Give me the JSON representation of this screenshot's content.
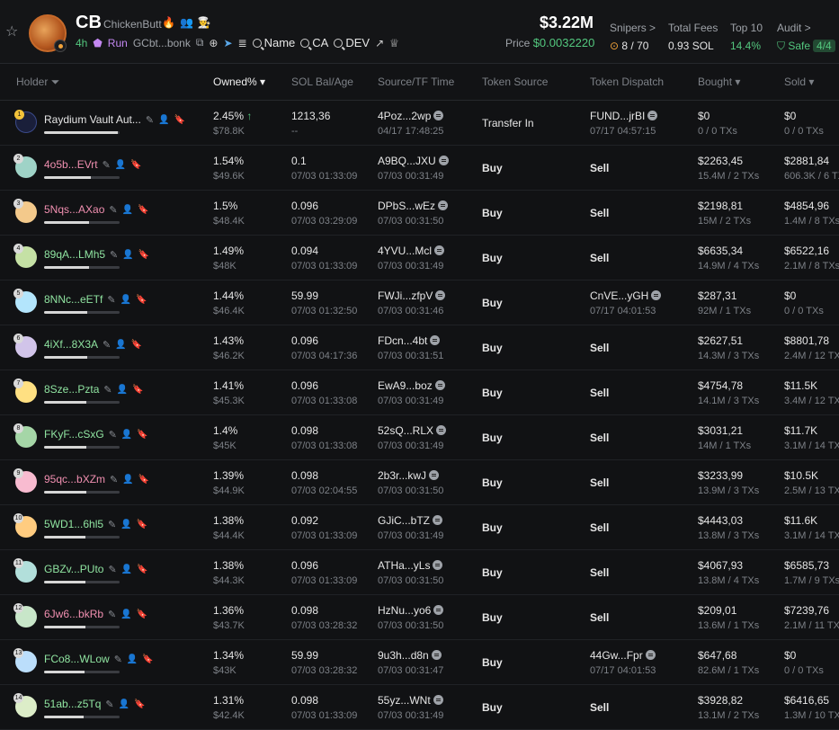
{
  "header": {
    "symbol": "CB",
    "name": "ChickenButt",
    "age": "4h",
    "status": "Run",
    "contract": "GCbt...bonk",
    "buttons": {
      "name": "Name",
      "ca": "CA",
      "dev": "DEV"
    },
    "market_cap": "$3.22M",
    "price_label": "Price",
    "price": "$0.0032220",
    "snipers_label": "Snipers >",
    "snipers": "8 / 70",
    "fees_label": "Total Fees",
    "fees": "0.93 SOL",
    "top10_label": "Top 10",
    "top10": "14.4%",
    "audit_label": "Audit >",
    "audit_status": "Safe",
    "audit_score": "4/4"
  },
  "columns": {
    "holder": "Holder",
    "owned": "Owned%",
    "sol_bal": "SOL Bal/Age",
    "source_tf": "Source/TF Time",
    "token_source": "Token Source",
    "token_dispatch": "Token Dispatch",
    "bought": "Bought",
    "sold": "Sold"
  },
  "rows": [
    {
      "rank": "1",
      "addr": "Raydium Vault Aut...",
      "addr_color": "#e6e6e6",
      "share": 0.245,
      "owned": "2.45%",
      "owned_usd": "$78.8K",
      "sol": "1213,36",
      "age": "--",
      "src": "4Poz...2wp",
      "src_time": "04/17 17:48:25",
      "tsrc": "Transfer In",
      "disp": "FUND...jrBI",
      "disp_time": "07/17 04:57:15",
      "bought": "$0",
      "bought_tx": "0 / 0 TXs",
      "sold": "$0",
      "sold_tx": "0 / 0 TXs",
      "icon": "raydium"
    },
    {
      "rank": "2",
      "addr": "4o5b...EVrt",
      "addr_color": "#f08fb0",
      "share": 0.154,
      "owned": "1.54%",
      "owned_usd": "$49.6K",
      "sol": "0.1",
      "age": "07/03 01:33:09",
      "src": "A9BQ...JXU",
      "src_time": "07/03 00:31:49",
      "tsrc": "Buy",
      "disp": "Sell",
      "disp_time": "",
      "bought": "$2263,45",
      "bought_tx": "15.4M / 2 TXs",
      "sold": "$2881,84",
      "sold_tx": "606.3K / 6 TX"
    },
    {
      "rank": "3",
      "addr": "5Nqs...AXao",
      "addr_color": "#f08fb0",
      "share": 0.15,
      "owned": "1.5%",
      "owned_usd": "$48.4K",
      "sol": "0.096",
      "age": "07/03 03:29:09",
      "src": "DPbS...wEz",
      "src_time": "07/03 00:31:50",
      "tsrc": "Buy",
      "disp": "Sell",
      "disp_time": "",
      "bought": "$2198,81",
      "bought_tx": "15M / 2 TXs",
      "sold": "$4854,96",
      "sold_tx": "1.4M / 8 TXs"
    },
    {
      "rank": "4",
      "addr": "89qA...LMh5",
      "addr_color": "#8fe3a0",
      "share": 0.149,
      "owned": "1.49%",
      "owned_usd": "$48K",
      "sol": "0.094",
      "age": "07/03 01:33:09",
      "src": "4YVU...Mcl",
      "src_time": "07/03 00:31:49",
      "tsrc": "Buy",
      "disp": "Sell",
      "disp_time": "",
      "bought": "$6635,34",
      "bought_tx": "14.9M / 4 TXs",
      "sold": "$6522,16",
      "sold_tx": "2.1M / 8 TXs"
    },
    {
      "rank": "5",
      "addr": "8NNc...eETf",
      "addr_color": "#8fe3a0",
      "share": 0.144,
      "owned": "1.44%",
      "owned_usd": "$46.4K",
      "sol": "59.99",
      "age": "07/03 01:32:50",
      "src": "FWJi...zfpV",
      "src_time": "07/03 00:31:46",
      "tsrc": "Buy",
      "disp": "CnVE...yGH",
      "disp_time": "07/17 04:01:53",
      "bought": "$287,31",
      "bought_tx": "92M / 1 TXs",
      "sold": "$0",
      "sold_tx": "0 / 0 TXs"
    },
    {
      "rank": "6",
      "addr": "4iXf...8X3A",
      "addr_color": "#8fe3a0",
      "share": 0.143,
      "owned": "1.43%",
      "owned_usd": "$46.2K",
      "sol": "0.096",
      "age": "07/03 04:17:36",
      "src": "FDcn...4bt",
      "src_time": "07/03 00:31:51",
      "tsrc": "Buy",
      "disp": "Sell",
      "disp_time": "",
      "bought": "$2627,51",
      "bought_tx": "14.3M / 3 TXs",
      "sold": "$8801,78",
      "sold_tx": "2.4M / 12 TX"
    },
    {
      "rank": "7",
      "addr": "8Sze...Pzta",
      "addr_color": "#8fe3a0",
      "share": 0.141,
      "owned": "1.41%",
      "owned_usd": "$45.3K",
      "sol": "0.096",
      "age": "07/03 01:33:08",
      "src": "EwA9...boz",
      "src_time": "07/03 00:31:49",
      "tsrc": "Buy",
      "disp": "Sell",
      "disp_time": "",
      "bought": "$4754,78",
      "bought_tx": "14.1M / 3 TXs",
      "sold": "$11.5K",
      "sold_tx": "3.4M / 12 TX"
    },
    {
      "rank": "8",
      "addr": "FKyF...cSxG",
      "addr_color": "#8fe3a0",
      "share": 0.14,
      "owned": "1.4%",
      "owned_usd": "$45K",
      "sol": "0.098",
      "age": "07/03 01:33:08",
      "src": "52sQ...RLX",
      "src_time": "07/03 00:31:49",
      "tsrc": "Buy",
      "disp": "Sell",
      "disp_time": "",
      "bought": "$3031,21",
      "bought_tx": "14M / 1 TXs",
      "sold": "$11.7K",
      "sold_tx": "3.1M / 14 TX"
    },
    {
      "rank": "9",
      "addr": "95qc...bXZm",
      "addr_color": "#f08fb0",
      "share": 0.139,
      "owned": "1.39%",
      "owned_usd": "$44.9K",
      "sol": "0.098",
      "age": "07/03 02:04:55",
      "src": "2b3r...kwJ",
      "src_time": "07/03 00:31:50",
      "tsrc": "Buy",
      "disp": "Sell",
      "disp_time": "",
      "bought": "$3233,99",
      "bought_tx": "13.9M / 3 TXs",
      "sold": "$10.5K",
      "sold_tx": "2.5M / 13 TX"
    },
    {
      "rank": "10",
      "addr": "5WD1...6hl5",
      "addr_color": "#8fe3a0",
      "share": 0.138,
      "owned": "1.38%",
      "owned_usd": "$44.4K",
      "sol": "0.092",
      "age": "07/03 01:33:09",
      "src": "GJiC...bTZ",
      "src_time": "07/03 00:31:49",
      "tsrc": "Buy",
      "disp": "Sell",
      "disp_time": "",
      "bought": "$4443,03",
      "bought_tx": "13.8M / 3 TXs",
      "sold": "$11.6K",
      "sold_tx": "3.1M / 14 TX"
    },
    {
      "rank": "11",
      "addr": "GBZv...PUto",
      "addr_color": "#8fe3a0",
      "share": 0.138,
      "owned": "1.38%",
      "owned_usd": "$44.3K",
      "sol": "0.096",
      "age": "07/03 01:33:09",
      "src": "ATHa...yLs",
      "src_time": "07/03 00:31:50",
      "tsrc": "Buy",
      "disp": "Sell",
      "disp_time": "",
      "bought": "$4067,93",
      "bought_tx": "13.8M / 4 TXs",
      "sold": "$6585,73",
      "sold_tx": "1.7M / 9 TXs"
    },
    {
      "rank": "12",
      "addr": "6Jw6...bkRb",
      "addr_color": "#f08fb0",
      "share": 0.136,
      "owned": "1.36%",
      "owned_usd": "$43.7K",
      "sol": "0.098",
      "age": "07/03 03:28:32",
      "src": "HzNu...yo6",
      "src_time": "07/03 00:31:50",
      "tsrc": "Buy",
      "disp": "Sell",
      "disp_time": "",
      "bought": "$209,01",
      "bought_tx": "13.6M / 1 TXs",
      "sold": "$7239,76",
      "sold_tx": "2.1M / 11 TX"
    },
    {
      "rank": "13",
      "addr": "FCo8...WLow",
      "addr_color": "#8fe3a0",
      "share": 0.134,
      "owned": "1.34%",
      "owned_usd": "$43K",
      "sol": "59.99",
      "age": "07/03 03:28:32",
      "src": "9u3h...d8n",
      "src_time": "07/03 00:31:47",
      "tsrc": "Buy",
      "disp": "44Gw...Fpr",
      "disp_time": "07/17 04:01:53",
      "bought": "$647,68",
      "bought_tx": "82.6M / 1 TXs",
      "sold": "$0",
      "sold_tx": "0 / 0 TXs"
    },
    {
      "rank": "14",
      "addr": "51ab...z5Tq",
      "addr_color": "#8fe3a0",
      "share": 0.131,
      "owned": "1.31%",
      "owned_usd": "$42.4K",
      "sol": "0.098",
      "age": "07/03 01:33:09",
      "src": "55yz...WNt",
      "src_time": "07/03 00:31:49",
      "tsrc": "Buy",
      "disp": "Sell",
      "disp_time": "",
      "bought": "$3928,82",
      "bought_tx": "13.1M / 2 TXs",
      "sold": "$6416,65",
      "sold_tx": "1.3M / 10 TX"
    }
  ]
}
